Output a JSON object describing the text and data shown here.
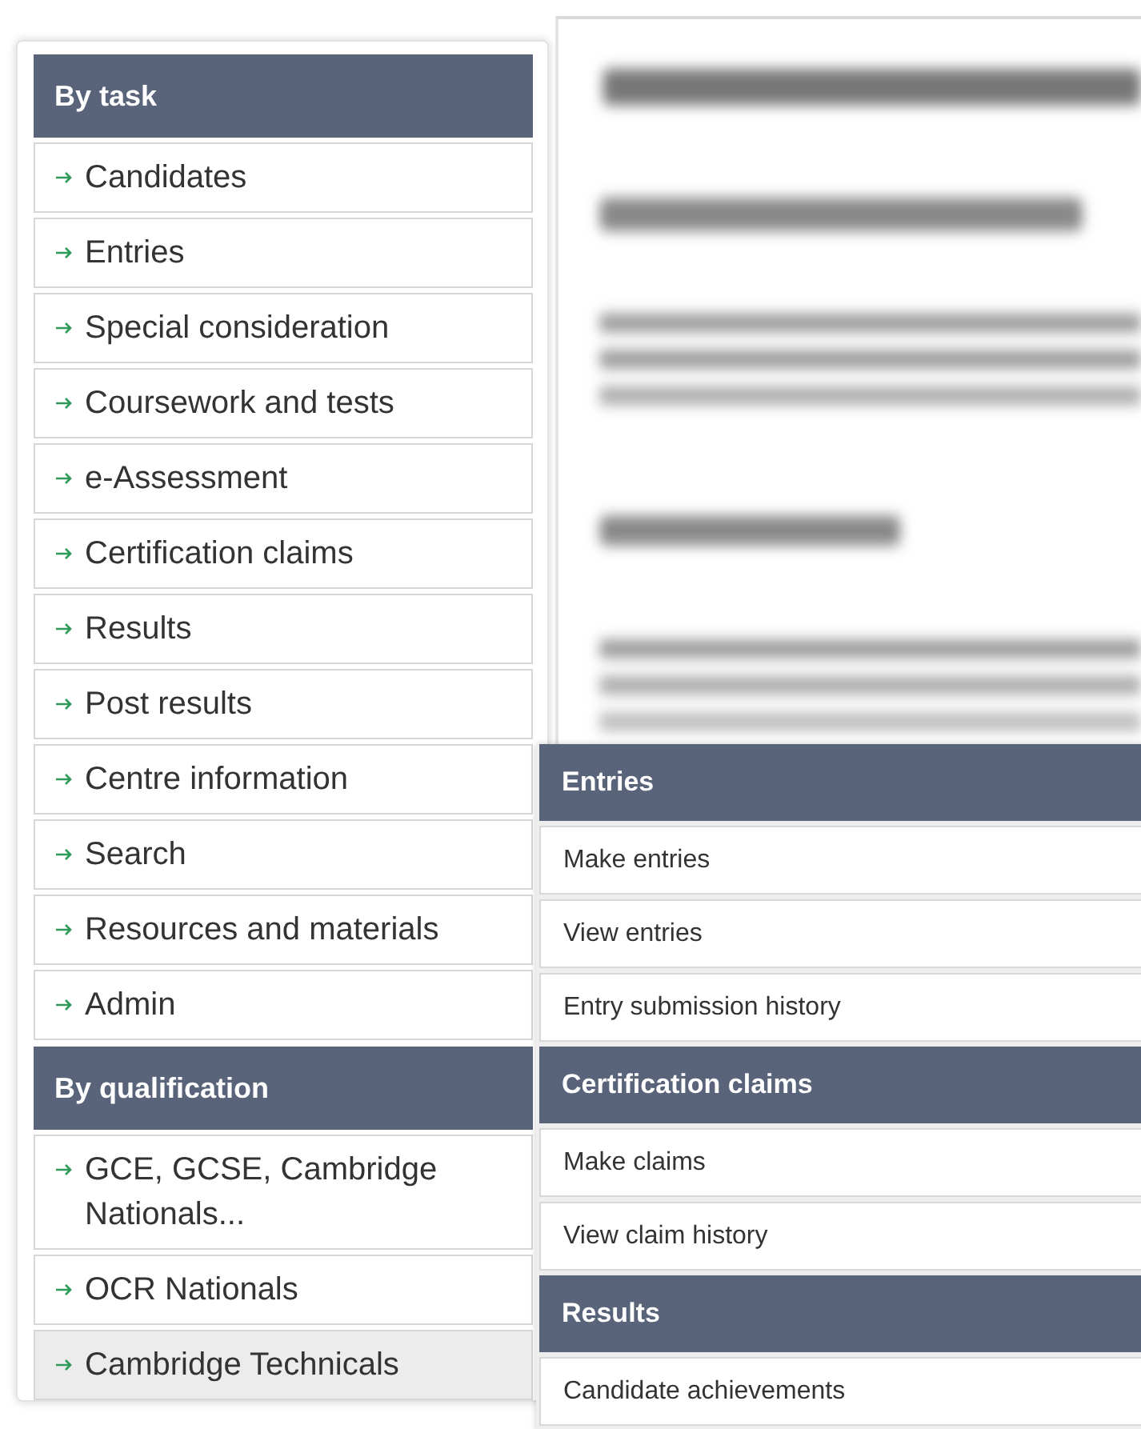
{
  "sidebar": {
    "sections": [
      {
        "heading": "By task",
        "items": [
          {
            "label": "Candidates",
            "selected": false
          },
          {
            "label": "Entries",
            "selected": false
          },
          {
            "label": "Special consideration",
            "selected": false
          },
          {
            "label": "Coursework and tests",
            "selected": false
          },
          {
            "label": "e-Assessment",
            "selected": false
          },
          {
            "label": "Certification claims",
            "selected": false
          },
          {
            "label": "Results",
            "selected": false
          },
          {
            "label": "Post results",
            "selected": false
          },
          {
            "label": "Centre information",
            "selected": false
          },
          {
            "label": "Search",
            "selected": false
          },
          {
            "label": "Resources and materials",
            "selected": false
          },
          {
            "label": "Admin",
            "selected": false
          }
        ]
      },
      {
        "heading": "By qualification",
        "items": [
          {
            "label": "GCE, GCSE, Cambridge Nationals...",
            "selected": false
          },
          {
            "label": "OCR Nationals",
            "selected": false
          },
          {
            "label": "Cambridge Technicals",
            "selected": true
          }
        ]
      }
    ]
  },
  "flyout": {
    "groups": [
      {
        "heading": "Entries",
        "items": [
          "Make entries",
          "View entries",
          "Entry submission history"
        ]
      },
      {
        "heading": "Certification claims",
        "items": [
          "Make claims",
          "View claim history"
        ]
      },
      {
        "heading": "Results",
        "items": [
          "Candidate achievements"
        ]
      }
    ]
  }
}
